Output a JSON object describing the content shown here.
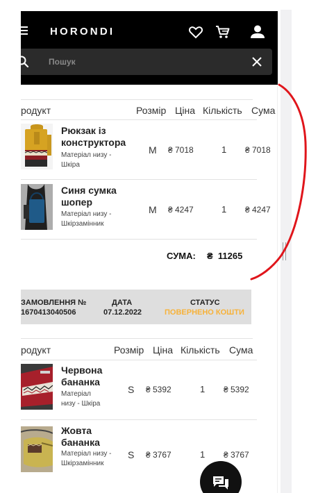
{
  "header": {
    "logo": "HORONDI",
    "search_placeholder": "Пошук",
    "icons": [
      "menu-icon",
      "heart-icon",
      "cart-icon",
      "user-icon",
      "search-icon",
      "close-icon"
    ]
  },
  "order1": {
    "columns": [
      "родукт",
      "Розмір",
      "Ціна",
      "Кількість",
      "Сума"
    ],
    "items": [
      {
        "name": "Рюкзак із конструктора",
        "material": "Матеріал низу - Шкіра",
        "size": "M",
        "price": "₴ 7018",
        "qty": "1",
        "sum": "₴ 7018"
      },
      {
        "name": "Синя сумка шопер",
        "material": "Матеріал низу - Шкірзамінник",
        "size": "M",
        "price": "₴ 4247",
        "qty": "1",
        "sum": "₴ 4247"
      }
    ],
    "total_label": "СУМА:",
    "total_value": "₴  11265"
  },
  "order2": {
    "number_label": "ЗАМОВЛЕННЯ №",
    "number_value": "1670413040506",
    "date_label": "ДАТА",
    "date_value": "07.12.2022",
    "status_label": "СТАТУС",
    "status_value": "ПОВЕРНЕНО КОШТИ",
    "columns": [
      "родукт",
      "Розмір",
      "Ціна",
      "Кількість",
      "Сума"
    ],
    "items": [
      {
        "name": "Червона бананка",
        "material": "Матеріал низу - Шкіра",
        "size": "S",
        "price": "₴ 5392",
        "qty": "1",
        "sum": "₴ 5392"
      },
      {
        "name": "Жовта бананка",
        "material": "Матеріал низу - Шкірзамінник",
        "size": "S",
        "price": "₴ 3767",
        "qty": "1",
        "sum": "₴ 3767"
      }
    ]
  },
  "colors": {
    "header_bg": "#000000",
    "search_bg": "#2b2b2b",
    "status": "#f7b23a",
    "order_bar": "#dedede",
    "annotation": "#e0151b"
  }
}
